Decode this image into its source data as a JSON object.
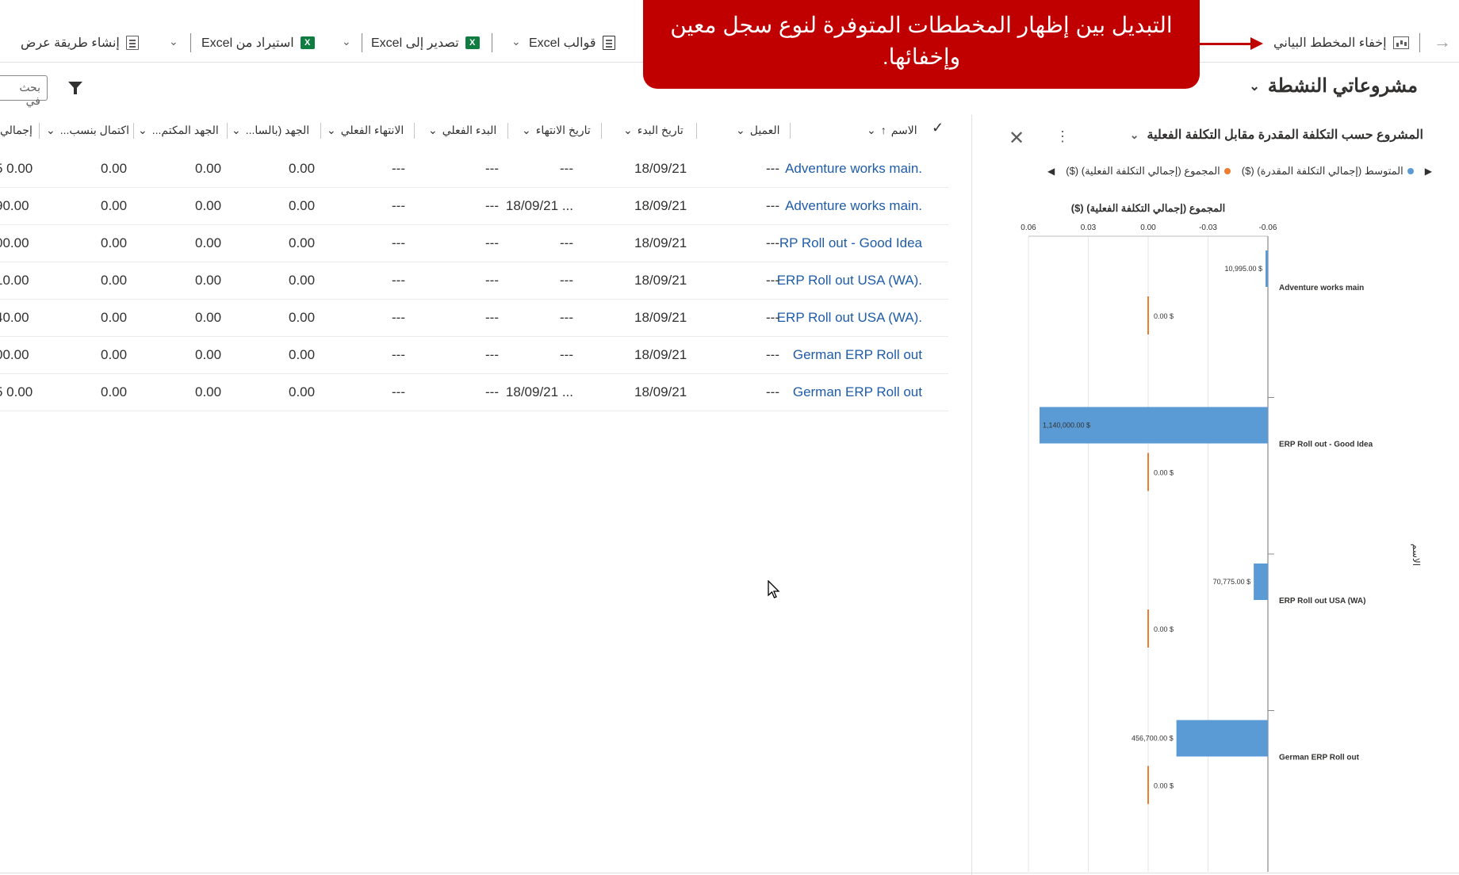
{
  "toolbar": {
    "back_icon": "arrow-icon",
    "hide_chart": "إخفاء المخطط البياني",
    "more": "...",
    "excel_templates": "قوالب Excel",
    "export_excel": "تصدير إلى Excel",
    "import_excel": "استيراد من Excel",
    "create_view": "إنشاء طريقة عرض",
    "excel_badge": "X"
  },
  "callout": {
    "line1": "التبديل بين إظهار المخططات المتوفرة لنوع سجل معين",
    "line2": "وإخفائها."
  },
  "view": {
    "title": "مشروعاتي النشطة",
    "search_placeholder": "بحث في"
  },
  "grid": {
    "columns": [
      "الاسم",
      "العميل",
      "تاريخ البدء",
      "تاريخ الانتهاء",
      "البدء الفعلي",
      "الانتهاء الفعلي",
      "الجهد (بالسا...",
      "الجهد المكتم...",
      "اكتمال بنسب...",
      "إجمالي"
    ],
    "rows": [
      {
        "name": "Adventure works main.",
        "customer": "---",
        "start": "18/09/21",
        "end": "---",
        "actual_start": "---",
        "actual_end": "---",
        "effort": "0.00",
        "effort_done": "0.00",
        "pct": "0.00",
        "total": "5 0.00"
      },
      {
        "name": "Adventure works main.",
        "customer": "---",
        "start": "18/09/21",
        "end": "18/09/21 ...",
        "actual_start": "---",
        "actual_end": "---",
        "effort": "0.00",
        "effort_done": "0.00",
        "pct": "0.00",
        "total": "90.00"
      },
      {
        "name": "RP Roll out - Good Idea",
        "customer": "---",
        "start": "18/09/21",
        "end": "---",
        "actual_start": "---",
        "actual_end": "---",
        "effort": "0.00",
        "effort_done": "0.00",
        "pct": "0.00",
        "total": "00.00"
      },
      {
        "name": "ERP Roll out USA (WA).",
        "customer": "---",
        "start": "18/09/21",
        "end": "---",
        "actual_start": "---",
        "actual_end": "---",
        "effort": "0.00",
        "effort_done": "0.00",
        "pct": "0.00",
        "total": "10.00"
      },
      {
        "name": "ERP Roll out USA (WA).",
        "customer": "---",
        "start": "18/09/21",
        "end": "---",
        "actual_start": "---",
        "actual_end": "---",
        "effort": "0.00",
        "effort_done": "0.00",
        "pct": "0.00",
        "total": "40.00"
      },
      {
        "name": "German ERP Roll out",
        "customer": "---",
        "start": "18/09/21",
        "end": "---",
        "actual_start": "---",
        "actual_end": "---",
        "effort": "0.00",
        "effort_done": "0.00",
        "pct": "0.00",
        "total": "00.00"
      },
      {
        "name": "German ERP Roll out",
        "customer": "---",
        "start": "18/09/21",
        "end": "18/09/21 ...",
        "actual_start": "---",
        "actual_end": "---",
        "effort": "0.00",
        "effort_done": "0.00",
        "pct": "0.00",
        "total": "5 0.00"
      }
    ]
  },
  "chart_panel": {
    "title": "المشروع حسب التكلفة المقدرة مقابل التكلفة الفعلية",
    "legend_avg": "المتوسط (إجمالي التكلفة المقدرة) ($)",
    "legend_sum": "المجموع (إجمالي التكلفة الفعلية) ($)"
  },
  "colors": {
    "callout": "#c00000",
    "link": "#1f5ca8",
    "bar_blue": "#5b9bd5",
    "bar_orange": "#ed7d31"
  },
  "chart_data": {
    "type": "bar",
    "orientation": "horizontal",
    "axis_title": "($) المجموع (إجمالي التكلفة الفعلية)",
    "ticks": [
      "0.06",
      "0.03",
      "0.00",
      "-0.03",
      "-0.06"
    ],
    "y_axis_label": "الاسم",
    "categories": [
      "Adventure works main",
      "ERP Roll out - Good Idea",
      "ERP Roll out USA (WA)",
      "German ERP Roll out"
    ],
    "series": [
      {
        "name": "المتوسط (إجمالي التكلفة المقدرة) ($)",
        "values": [
          10995,
          1140000,
          70775,
          456700
        ],
        "labels": [
          "10,995.00 $",
          "1,140,000.00 $",
          "70,775.00 $",
          "456,700.00 $"
        ]
      },
      {
        "name": "المجموع (إجمالي التكلفة الفعلية) ($)",
        "values": [
          0,
          0,
          0,
          0
        ],
        "labels": [
          "0.00 $",
          "0.00 $",
          "0.00 $",
          "0.00 $"
        ]
      }
    ]
  }
}
